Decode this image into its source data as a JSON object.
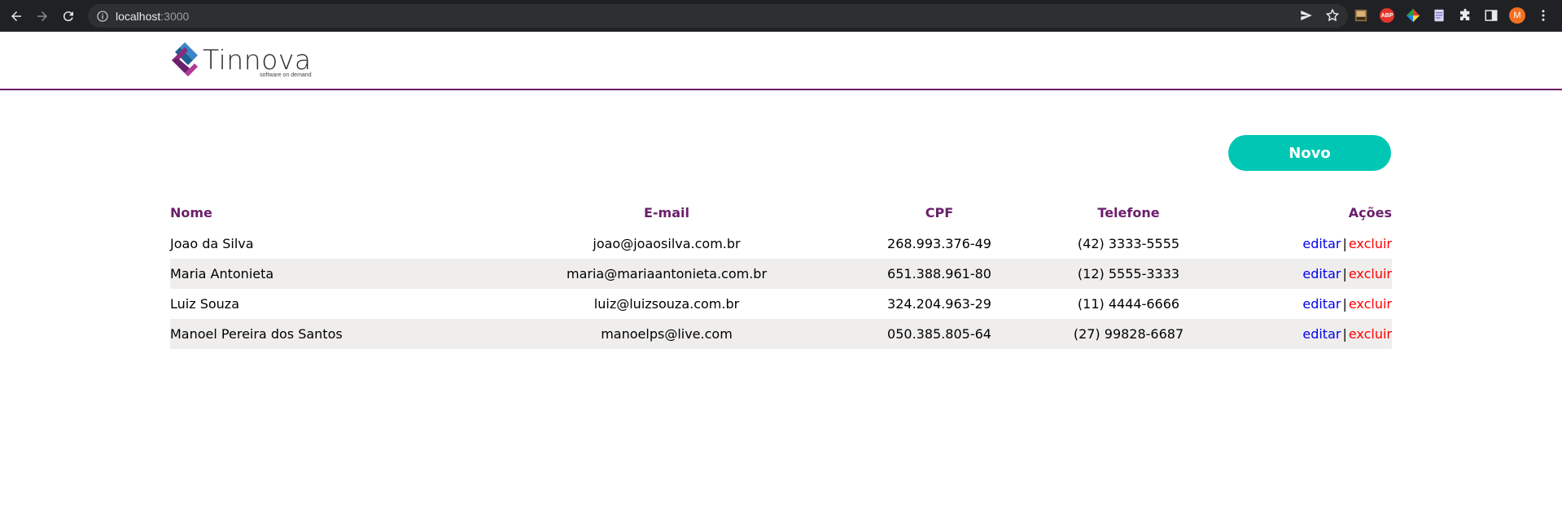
{
  "browser": {
    "url_host": "localhost",
    "url_port": ":3000",
    "avatar_letter": "M",
    "abp_label": "ABP"
  },
  "header": {
    "logo_name": "Tinnova",
    "logo_tagline": "software on demand"
  },
  "main": {
    "new_button_label": "Novo",
    "table": {
      "columns": [
        "Nome",
        "E-mail",
        "CPF",
        "Telefone",
        "Ações"
      ],
      "rows": [
        {
          "nome": "Joao da Silva",
          "email": "joao@joaosilva.com.br",
          "cpf": "268.993.376-49",
          "telefone": "(42) 3333-5555"
        },
        {
          "nome": "Maria Antonieta",
          "email": "maria@mariaantonieta.com.br",
          "cpf": "651.388.961-80",
          "telefone": "(12) 5555-3333"
        },
        {
          "nome": "Luiz Souza",
          "email": "luiz@luizsouza.com.br",
          "cpf": "324.204.963-29",
          "telefone": "(11) 4444-6666"
        },
        {
          "nome": "Manoel Pereira dos Santos",
          "email": "manoelps@live.com",
          "cpf": "050.385.805-64",
          "telefone": "(27) 99828-6687"
        }
      ],
      "action_edit_label": "editar",
      "action_separator": "|",
      "action_delete_label": "excluir"
    }
  },
  "colors": {
    "brand_purple": "#6b1f6b",
    "accent_teal": "#00c7b3",
    "edit_link": "#0000ee",
    "delete_link": "#ff0000",
    "row_alt": "#efeeed"
  }
}
